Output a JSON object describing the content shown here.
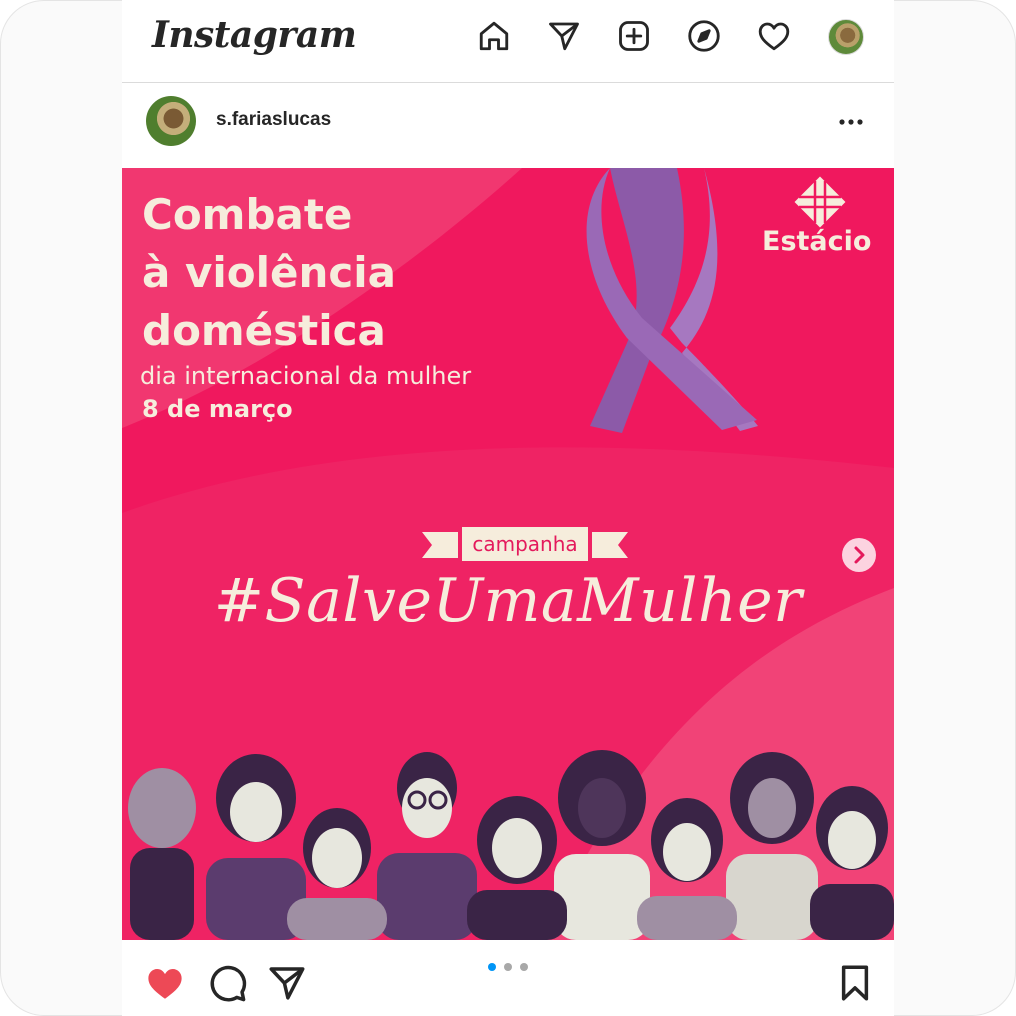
{
  "app": {
    "logo": "Instagram",
    "nav_icons": [
      "home-icon",
      "direct-icon",
      "new-post-icon",
      "explore-icon",
      "activity-icon"
    ]
  },
  "post": {
    "username": "s.fariaslucas",
    "more_label": "...",
    "image": {
      "headline": "Combate\nà violência\ndoméstica",
      "subhead": "dia internacional da mulher",
      "date": "8 de março",
      "brand": "Estácio",
      "campaign_label": "campanha",
      "hashtag": "#SalveUmaMulher"
    },
    "carousel": {
      "count": 3,
      "active_index": 0
    }
  },
  "colors": {
    "image_bg": "#f0185e",
    "ribbon": "#8c5aa8",
    "text_cream": "#f6eddc",
    "like_red": "#ed4956",
    "dot_active": "#0095f6",
    "dot_inactive": "#a8a8a8"
  }
}
